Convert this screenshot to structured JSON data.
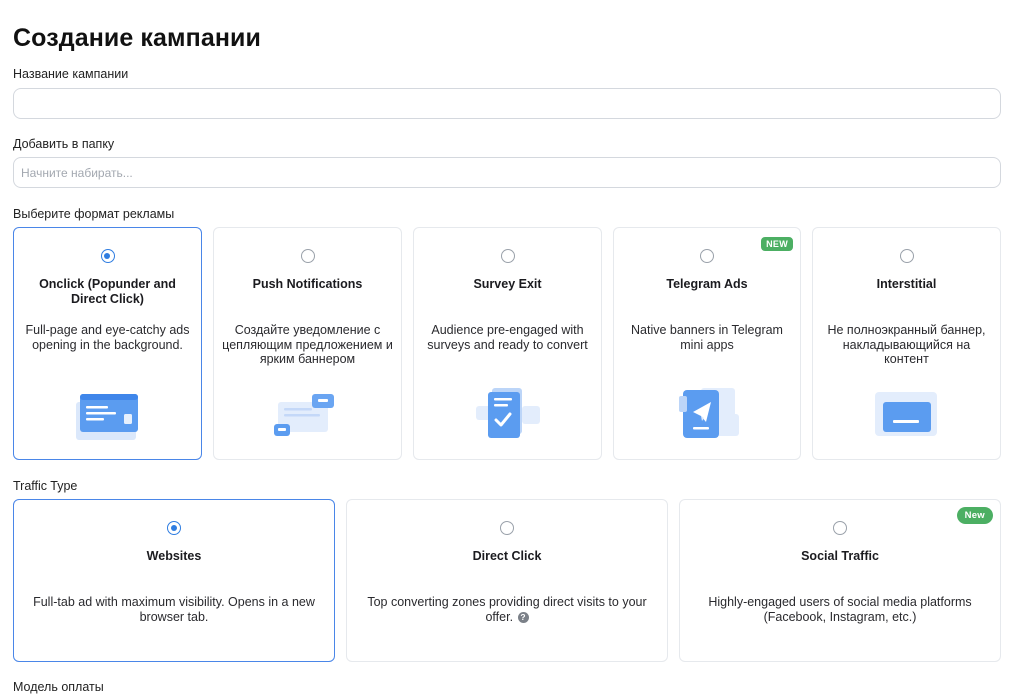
{
  "header": {
    "title": "Создание кампании"
  },
  "campaign_name": {
    "label": "Название кампании",
    "value": ""
  },
  "folder": {
    "label": "Добавить в папку",
    "placeholder": "Начните набирать..."
  },
  "ad_format": {
    "label": "Выберите формат рекламы",
    "options": [
      {
        "title": "Onclick (Popunder and Direct Click)",
        "description": "Full-page and eye-catchy ads opening in the background.",
        "selected": true,
        "icon": "browser-window-icon"
      },
      {
        "title": "Push Notifications",
        "description": "Создайте уведомление с цепляющим предложением и ярким баннером",
        "selected": false,
        "icon": "notification-cards-icon"
      },
      {
        "title": "Survey Exit",
        "description": "Audience pre-engaged with surveys and ready to convert",
        "selected": false,
        "icon": "survey-checklist-icon"
      },
      {
        "title": "Telegram Ads",
        "description": "Native banners in Telegram mini apps",
        "selected": false,
        "badge": "NEW",
        "icon": "telegram-phone-icon"
      },
      {
        "title": "Interstitial",
        "description": "Не полноэкранный баннер, накладывающийся на контент",
        "selected": false,
        "icon": "overlay-banner-icon"
      }
    ]
  },
  "traffic_type": {
    "label": "Traffic Type",
    "options": [
      {
        "title": "Websites",
        "description": "Full-tab ad with maximum visibility. Opens in a new browser tab.",
        "selected": true
      },
      {
        "title": "Direct Click",
        "description": "Top converting zones providing direct visits to your offer.",
        "selected": false,
        "help_icon": "?"
      },
      {
        "title": "Social Traffic",
        "description": "Highly-engaged users of social media platforms (Facebook, Instagram, etc.)",
        "selected": false,
        "badge": "New"
      }
    ]
  },
  "payment_model": {
    "label": "Модель оплаты"
  },
  "colors": {
    "accent": "#2f7de1",
    "badge_green": "#4caf63",
    "border": "#e6e9ed"
  }
}
